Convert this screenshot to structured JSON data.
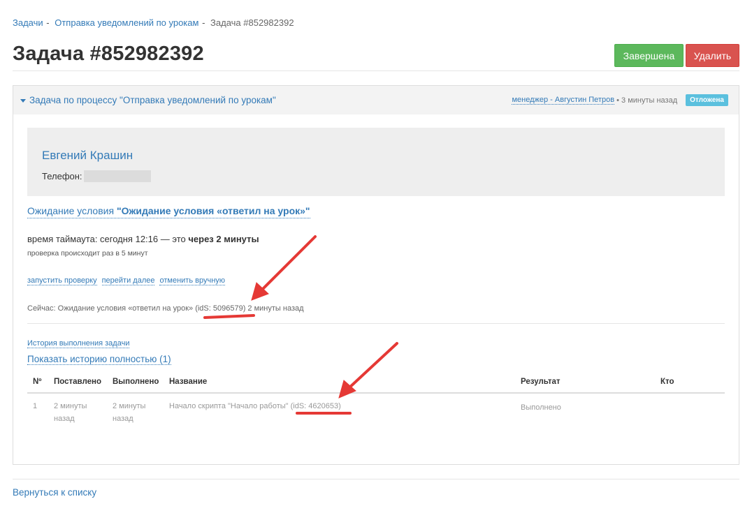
{
  "breadcrumb": {
    "items": [
      "Задачи",
      "Отправка уведомлений по урокам"
    ],
    "current": "Задача #852982392"
  },
  "page_title": "Задача #852982392",
  "buttons": {
    "complete": "Завершена",
    "delete": "Удалить"
  },
  "panel": {
    "title": "Задача по процессу \"Отправка уведомлений по урокам\"",
    "manager": "менеджер - Августин Петров",
    "time": "3 минуты назад",
    "status": "Отложена"
  },
  "contact": {
    "name": "Евгений Крашин",
    "phone_label": "Телефон:"
  },
  "wait": {
    "label": "Ожидание условия",
    "name": "\"Ожидание условия «ответил на урок»\""
  },
  "timeout": {
    "prefix": "время таймаута: сегодня 12:16 — это",
    "bold": "через 2 минуты"
  },
  "check_note": "проверка происходит раз в 5 минут",
  "actions": [
    "запустить проверку",
    "перейти далее",
    "отменить вручную"
  ],
  "now_line": "Сейчас: Ожидание условия «ответил на урок» (idS: 5096579) 2 минуты назад",
  "history": {
    "link": "История выполнения задачи",
    "show_full": "Показать историю полностью (1)"
  },
  "table": {
    "headers": [
      "Nº",
      "Поставлено",
      "Выполнено",
      "Название",
      "Результат",
      "Кто"
    ],
    "rows": [
      {
        "num": "1",
        "set": "2 минуты назад",
        "done": "2 минуты назад",
        "name": "Начало скрипта \"Начало работы\" (idS: 4620653)",
        "result": "Выполнено",
        "who": ""
      }
    ]
  },
  "back_link": "Вернуться к списку",
  "colors": {
    "primary": "#337ab7",
    "success": "#5cb85c",
    "danger": "#d9534f",
    "info": "#5bc0de",
    "annotation": "#e53935"
  }
}
